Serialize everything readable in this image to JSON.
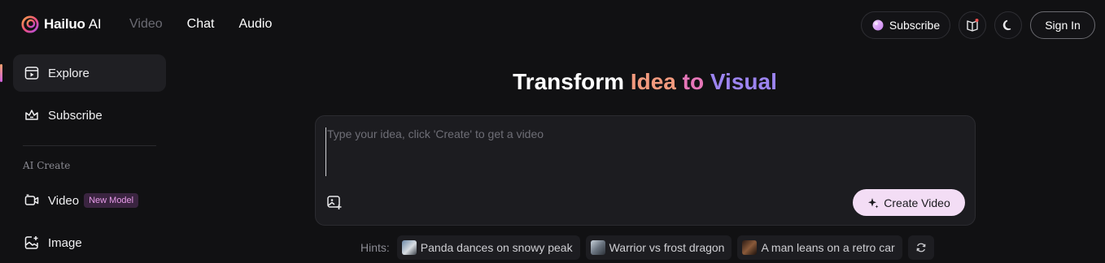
{
  "header": {
    "logo_text": "Hailuo",
    "logo_suffix": "AI",
    "nav": [
      {
        "label": "Video",
        "active": true
      },
      {
        "label": "Chat",
        "active": false
      },
      {
        "label": "Audio",
        "active": false
      }
    ],
    "subscribe_label": "Subscribe",
    "signin_label": "Sign In",
    "icons": [
      "gem-icon",
      "book-icon",
      "moon-icon"
    ]
  },
  "sidebar": {
    "items": [
      {
        "label": "Explore",
        "icon": "explore-icon",
        "active": true
      },
      {
        "label": "Subscribe",
        "icon": "crown-icon",
        "active": false
      }
    ],
    "section_label": "AI Create",
    "create_items": [
      {
        "label": "Video",
        "icon": "video-icon",
        "badge": "New Model"
      },
      {
        "label": "Image",
        "icon": "image-icon"
      }
    ]
  },
  "hero": {
    "title_plain": "Transform",
    "title_word1": "Idea",
    "title_word2": "to",
    "title_word3": "Visual"
  },
  "prompt": {
    "placeholder": "Type your idea, click 'Create' to get a video",
    "value": "",
    "create_label": "Create Video"
  },
  "hints": {
    "label": "Hints:",
    "items": [
      "Panda dances on snowy peak",
      "Warrior vs frost dragon",
      "A man leans on a retro car"
    ]
  },
  "colors": {
    "background": "#111113",
    "accent_orange": "#f29a7e",
    "accent_pink": "#e676b8",
    "accent_purple": "#9c84f0",
    "create_button": "#f3ddf5"
  }
}
